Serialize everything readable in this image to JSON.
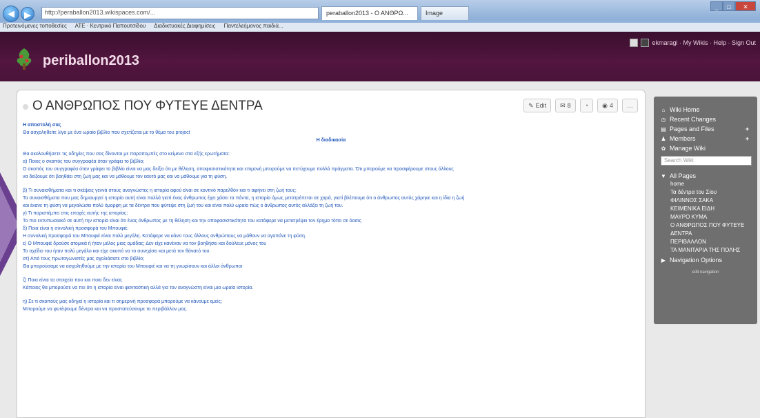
{
  "browser": {
    "address": "http://peraballon2013.wikispaces.com/...",
    "tabs": [
      "peraballon2013 - Ο ΑΝΘΡΩ...",
      "Image"
    ],
    "favorites": [
      "Προτεινόμενες τοποθεσίες",
      "ΑΤΕ · Κεντρικό Παπουτσίδου",
      "Διαδικτυακές Διαφημίσεις",
      "Παντελεήμονος παιδιά..."
    ]
  },
  "site": {
    "title": "periballon2013",
    "user_links": "ekmaragi · My Wikis · Help · Sign Out"
  },
  "page": {
    "title": "Ο ΑΝΘΡΩΠΟΣ ΠΟΥ ΦΥΤΕΥΕ ΔΕΝΤΡΑ",
    "toolbar": {
      "edit": "Edit",
      "count1": "8",
      "count2": "4"
    },
    "paragraphs": [
      {
        "text": "Η αποστολή σας",
        "style": "bold"
      },
      {
        "text": "Θα ασχοληθείτε λίγο με ένα ωραίο βιβλίο που σχετίζεται με το θέμα του project",
        "style": ""
      },
      {
        "text": "Η διαδικασία",
        "style": "center"
      },
      {
        "text": "",
        "style": "gap"
      },
      {
        "text": "Θα ακολουθήσετε τις οδηγίες που σας δίνονται με παραπομπές στο κείμενο στα εξής ερωτήματα:",
        "style": ""
      },
      {
        "text": "α) Ποιος ο σκοπός του συγγραφέα όταν γράφει το βιβλίο;",
        "style": ""
      },
      {
        "text": "Ο σκοπός του συγγραφέα όταν γράφει το βιβλίο είναι να μας δείξει ότι με θέληση, αποφασιστικότητα και επιμονή μπορούμε να πετύχουμε πολλά πράγματα. Ότι μπορούμε να προσφέρουμε στους άλλους",
        "style": ""
      },
      {
        "text": "να δείξουμε ότι βοηθάει στη ζωή μας και να μάθουμε τον εαυτό μας και να μάθουμε για τη φύση.",
        "style": ""
      },
      {
        "text": "",
        "style": "gap"
      },
      {
        "text": "β) Τι συναισθήματα και τι σκέψεις γεννά στους αναγνώστες η ιστορία αφού είναι σε κοντινό παρελθόν και τι αφήνει στη ζωή τους;",
        "style": ""
      },
      {
        "text": "Τα συναισθήματα που μας δημιουργεί η ιστορία αυτή είναι πολλά γιατί ένας άνθρωπος έχει χάσει τα πάντα, η ιστορία όμως μετατρέπεται σε χαρά, γιατί βλέπουμε ότι ο άνθρωπος αυτός χάρηκε και η ίδια η ζωή",
        "style": ""
      },
      {
        "text": "και έκανε τη φύση να μεγαλώσει πολύ όμορφη με τα δέντρα που φύτεψε στη ζωή του και είναι πολύ ωραίο πώς ο άνθρωπος αυτός αλλάζει τη ζωή του.",
        "style": ""
      },
      {
        "text": "γ) Τι παραπέμπει στις εποχές αυτής της ιστορίας;",
        "style": ""
      },
      {
        "text": "Το πιο εντυπωσιακό σε αυτή την ιστορία είναι ότι ένας άνθρωπος με τη θέληση και την αποφασιστικότητα του κατάφερε να μετατρέψει τον έρημο τόπο σε όασις",
        "style": ""
      },
      {
        "text": "δ) Ποια είναι η συνολική προσφορά του Μπουφιέ;",
        "style": ""
      },
      {
        "text": "Η συνολική προσφορά του Μπουφιέ είναι πολύ μεγάλη. Κατάφερε να κάνει τους άλλους ανθρώπους να μάθουν να αγαπάνε τη φύση.",
        "style": ""
      },
      {
        "text": "ε) Ο Μπουφιέ δρούσε ατομικά ή ήταν μέλος μιας ομάδας; Δεν είχε κανέναν να τον βοηθήσει και δούλευε μόνος του",
        "style": ""
      },
      {
        "text": "Το σχέδιο του ήταν πολύ μεγάλο και είχε σκοπό να το συνεχίσει και μετά τον θάνατό του.",
        "style": ""
      },
      {
        "text": "στ) Από τους πρωταγωνιστές μας σχολιάσατε στο βιβλίο;",
        "style": ""
      },
      {
        "text": "Θα μπορούσαμε να ασχοληθούμε με την ιστορία του Μπουφιέ και να τη γνωρίσουν και άλλοι άνθρωποι",
        "style": ""
      },
      {
        "text": "",
        "style": "gap"
      },
      {
        "text": "ζ) Ποια είναι τα στοιχεία που και ποιο δεν είναι;",
        "style": ""
      },
      {
        "text": "Κάποιος θα μπορούσε να πει ότι η ιστορία είναι φανταστική αλλά για τον αναγνώστη είναι μια ωραία ιστορία.",
        "style": ""
      },
      {
        "text": "",
        "style": "gap"
      },
      {
        "text": "η) Σε τι σκοπούς μας οδηγεί η ιστορία και τι σημερινή προσφορά μπορούμε να κάνουμε εμείς;",
        "style": ""
      },
      {
        "text": "Μπορούμε να φυτέψουμε δέντρα και να προστατεύσουμε το περιβάλλον μας.",
        "style": ""
      }
    ]
  },
  "sidebar": {
    "items": [
      {
        "icon": "home-icon",
        "glyph": "⌂",
        "label": "Wiki Home",
        "plus": ""
      },
      {
        "icon": "clock-icon",
        "glyph": "◷",
        "label": "Recent Changes",
        "plus": ""
      },
      {
        "icon": "pages-icon",
        "glyph": "▤",
        "label": "Pages and Files",
        "plus": "+"
      },
      {
        "icon": "members-icon",
        "glyph": "♟",
        "label": "Members",
        "plus": "+"
      },
      {
        "icon": "gear-icon",
        "glyph": "✿",
        "label": "Manage Wiki",
        "plus": ""
      }
    ],
    "search_placeholder": "Search Wiki",
    "all_pages_label": "All Pages",
    "pages": [
      "home",
      "Τα δέντρα του Σίου",
      "ΦΙΛΙΝΝΟΣ ΣΑΚΑ",
      "ΚΕΙΜΕΝΙΚΑ ΕΙΔΗ",
      "ΜΑΥΡΟ ΚΥΜΑ",
      "Ο ΑΝΘΡΩΠΟΣ ΠΟΥ ΦΥΤΕΥΕ",
      "ΔΕΝΤΡΑ",
      "ΠΕΡΙΒΑΛΛΟΝ",
      "ΤΑ ΜΑΝΙΤΑΡΙΑ ΤΗΣ ΠΟΛΗΣ"
    ],
    "nav_options": "Navigation Options",
    "footer": "edit navigation"
  }
}
